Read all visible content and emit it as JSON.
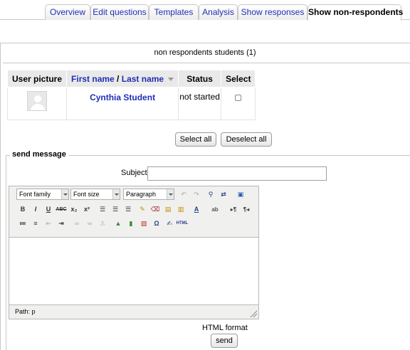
{
  "tabs": [
    {
      "label": "Overview",
      "active": false
    },
    {
      "label": "Edit questions",
      "active": false
    },
    {
      "label": "Templates",
      "active": false
    },
    {
      "label": "Analysis",
      "active": false
    },
    {
      "label": "Show responses",
      "active": false
    },
    {
      "label": "Show non-respondents",
      "active": true
    }
  ],
  "heading": "non respondents students (1)",
  "table": {
    "headers": {
      "picture": "User picture",
      "first_name": "First name",
      "separator": " / ",
      "last_name": "Last name",
      "status": "Status",
      "select": "Select"
    },
    "rows": [
      {
        "name": "Cynthia Student",
        "status": "not started",
        "selected": false
      }
    ]
  },
  "buttons": {
    "select_all": "Select all",
    "deselect_all": "Deselect all",
    "send": "send"
  },
  "message": {
    "legend": "send message",
    "subject_label": "Subject",
    "subject_value": "",
    "editor": {
      "font_family": "Font family",
      "font_size": "Font size",
      "format": "Paragraph",
      "path": "Path: p",
      "html_label": "HTML"
    },
    "format_label": "HTML format"
  },
  "colors": {
    "link": "#1f2fb4",
    "header_bg": "#e9e9e9",
    "border": "#c8c8c8"
  }
}
